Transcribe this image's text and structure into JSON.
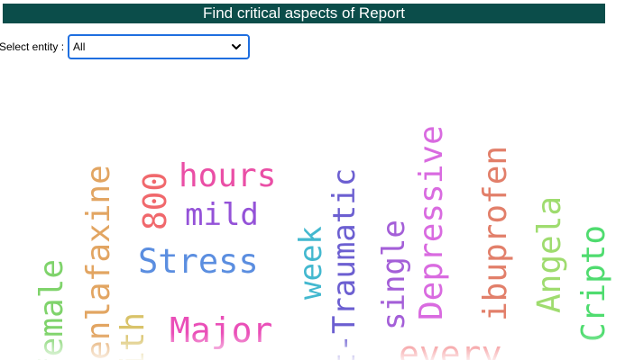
{
  "header": {
    "title": "Find critical aspects of Report"
  },
  "filter": {
    "label": "Select entity :",
    "selected": "All",
    "icon": "chevron-down-icon"
  },
  "word_cloud": {
    "words": [
      {
        "text": "female",
        "color": "#7fd36b"
      },
      {
        "text": "enlafaxine",
        "color": "#e2a562"
      },
      {
        "text": "ith",
        "color": "#d9c36a"
      },
      {
        "text": "800",
        "color": "#f0686c"
      },
      {
        "text": "hours",
        "color": "#ea4fa6"
      },
      {
        "text": "mild",
        "color": "#9452d8"
      },
      {
        "text": "Stress",
        "color": "#5b8ee0"
      },
      {
        "text": "Major",
        "color": "#ea4fb8"
      },
      {
        "text": "week",
        "color": "#43b8cf"
      },
      {
        "text": "t-Traumatic",
        "color": "#6c5fd1"
      },
      {
        "text": "single",
        "color": "#a45fd8"
      },
      {
        "text": "Depressive",
        "color": "#d96be0"
      },
      {
        "text": "every",
        "color": "#f0686c"
      },
      {
        "text": "ibuprofen",
        "color": "#e27f6a"
      },
      {
        "text": "Angela",
        "color": "#9fdc6f"
      },
      {
        "text": "Cripto",
        "color": "#4fdc6f"
      }
    ]
  }
}
